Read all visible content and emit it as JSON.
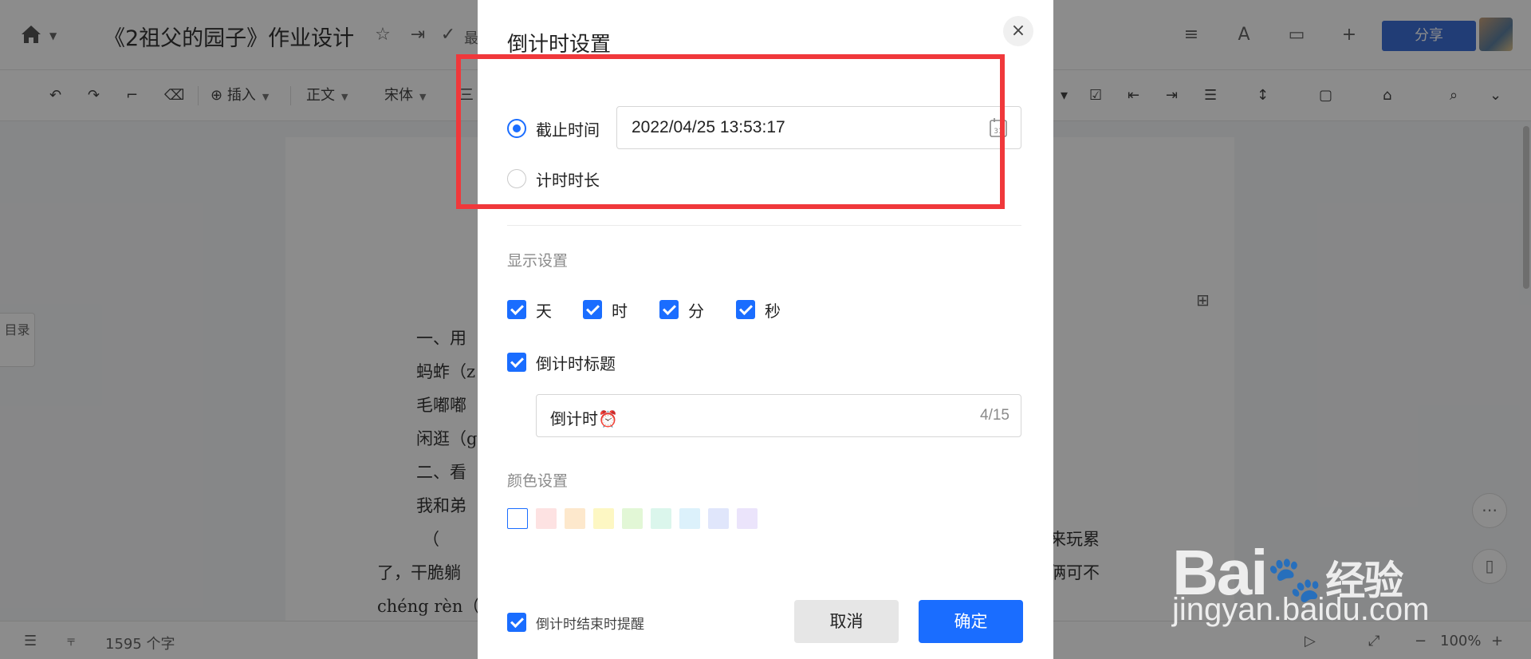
{
  "app": {
    "doc_title": "《2祖父的园子》作业设计",
    "recent_label": "最",
    "share_label": "分享",
    "toolbar": {
      "insert_label": "插入",
      "style_label": "正文",
      "font_label": "宋体",
      "size_label": "三"
    },
    "toc_label": "目录",
    "page_lines": [
      "一、用",
      "蚂蚱（z",
      "毛嘟嘟",
      "闲逛（g",
      "二、看",
      "我和弟",
      "（",
      "了，干脆躺",
      "chéng rèn（",
      "来玩累",
      "俩可不"
    ],
    "status": {
      "word_count": "1595 个字",
      "zoom": "100%"
    }
  },
  "dialog": {
    "title": "倒计时设置",
    "close_label": "×",
    "mode": {
      "deadline_label": "截止时间",
      "duration_label": "计时时长",
      "deadline_value": "2022/04/25 13:53:17",
      "calendar_glyph": "31"
    },
    "display": {
      "section_label": "显示设置",
      "units": [
        "天",
        "时",
        "分",
        "秒"
      ],
      "title_toggle_label": "倒计时标题",
      "title_value": "倒计时⏰",
      "title_count": "4/15"
    },
    "color": {
      "section_label": "颜色设置",
      "swatches": [
        "#ffffff",
        "#fde2e2",
        "#fde8cc",
        "#fdf7c3",
        "#e2f7d6",
        "#dbf6ec",
        "#dcf1fb",
        "#e0e6fb",
        "#ebe4fb"
      ]
    },
    "footer": {
      "reminder_label": "倒计时结束时提醒",
      "cancel_label": "取消",
      "ok_label": "确定"
    }
  },
  "watermark": {
    "brand": "Bai",
    "brand_suffix": "经验",
    "url": "jingyan.baidu.com"
  },
  "colors": {
    "accent": "#1a6dff",
    "highlight_box": "#f0383b",
    "share_button": "#3c6fd8"
  }
}
